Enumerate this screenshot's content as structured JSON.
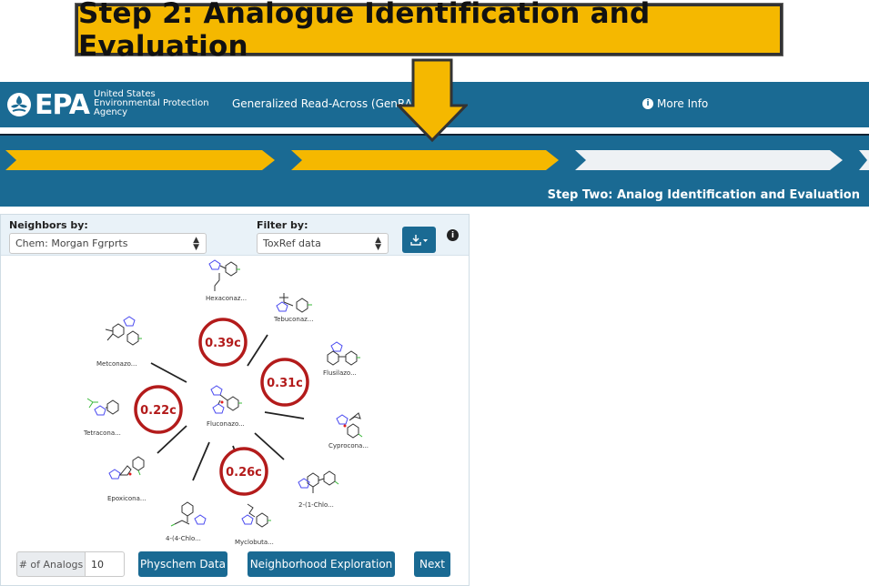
{
  "banner": {
    "title": "Step 2: Analogue Identification and Evaluation"
  },
  "header": {
    "logo_text": "EPA",
    "agency_lines": [
      "United States",
      "Environmental Protection",
      "Agency"
    ],
    "app_title": "Generalized Read-Across (GenRA)",
    "more_info": "More Info"
  },
  "progress": {
    "step_title": "Step Two: Analog Identification and Evaluation",
    "colors": {
      "done": "#f5b800",
      "pending": "#eef1f4",
      "band": "#1a6a93"
    }
  },
  "controls": {
    "neighbors_label": "Neighbors by:",
    "neighbors_value": "Chem: Morgan Fgrprts",
    "filter_label": "Filter by:",
    "filter_value": "ToxRef data"
  },
  "graph": {
    "center": "Fluconazo...",
    "neighbors": [
      "Hexaconaz...",
      "Tebuconaz...",
      "Flusilazo...",
      "Cyprocona...",
      "2-(1-Chlo...",
      "Myclobuta...",
      "4-(4-Chlo...",
      "Epoxicona...",
      "Tetracona...",
      "Metconazo..."
    ],
    "scores": [
      "0.39c",
      "0.31c",
      "0.22c",
      "0.26c"
    ],
    "score_color": "#b31b1b"
  },
  "footer": {
    "analogs_label": "# of Analogs",
    "analogs_value": "10",
    "physchem_button": "Physchem Data",
    "neighborhood_button": "Neighborhood Exploration",
    "next_button": "Next"
  }
}
